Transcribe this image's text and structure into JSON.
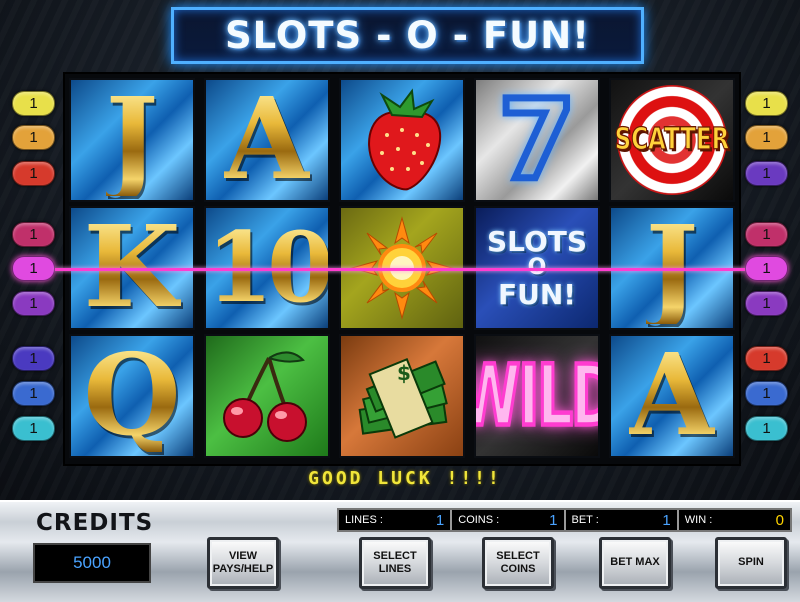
{
  "title": "SLOTS - O - FUN!",
  "reels": [
    [
      {
        "sym": "J"
      },
      {
        "sym": "K"
      },
      {
        "sym": "Q"
      }
    ],
    [
      {
        "sym": "A"
      },
      {
        "sym": "10"
      },
      {
        "sym": "cherries"
      }
    ],
    [
      {
        "sym": "strawberry"
      },
      {
        "sym": "sun"
      },
      {
        "sym": "cash"
      }
    ],
    [
      {
        "sym": "7"
      },
      {
        "sym": "SLOTS O FUN!"
      },
      {
        "sym": "WILD"
      }
    ],
    [
      {
        "sym": "SCATTER"
      },
      {
        "sym": "J"
      },
      {
        "sym": "A"
      }
    ]
  ],
  "slots_logo": {
    "l1": "SLOTS",
    "l2": "O",
    "l3": "FUN!"
  },
  "wild_label": "WILD",
  "scatter_label": "SCATTER",
  "line_indicators": {
    "left": [
      "1",
      "1",
      "1",
      "1",
      "1",
      "1",
      "1",
      "1",
      "1"
    ],
    "right": [
      "1",
      "1",
      "1",
      "1",
      "1",
      "1",
      "1",
      "1",
      "1"
    ],
    "colors": [
      "#e8e04a",
      "#e3a23a",
      "#d63a2c",
      "#c0306a",
      "#e04ae0",
      "#8a3ac0",
      "#4a3ac0",
      "#3a6ad0",
      "#3abfd0"
    ],
    "right_colors": [
      "#e8e04a",
      "#e3a23a",
      "#6a3ac0",
      "#c0306a",
      "#e04ae0",
      "#8a3ac0",
      "#d63a2c",
      "#3a6ad0",
      "#3abfd0"
    ]
  },
  "status_message": "GOOD LUCK !!!!",
  "credits": {
    "label": "CREDITS",
    "value": "5000"
  },
  "info": {
    "lines_label": "LINES :",
    "lines_value": "1",
    "coins_label": "COINS :",
    "coins_value": "1",
    "bet_label": "BET :",
    "bet_value": "1",
    "win_label": "WIN :",
    "win_value": "0"
  },
  "buttons": {
    "view_pays": "VIEW PAYS/HELP",
    "select_lines": "SELECT LINES",
    "select_coins": "SELECT COINS",
    "bet_max": "BET MAX",
    "spin": "SPIN"
  },
  "colors": {
    "payline": "#ff3cd0",
    "title_glow": "#2e8bff",
    "accent_blue": "#4aa3ff"
  }
}
